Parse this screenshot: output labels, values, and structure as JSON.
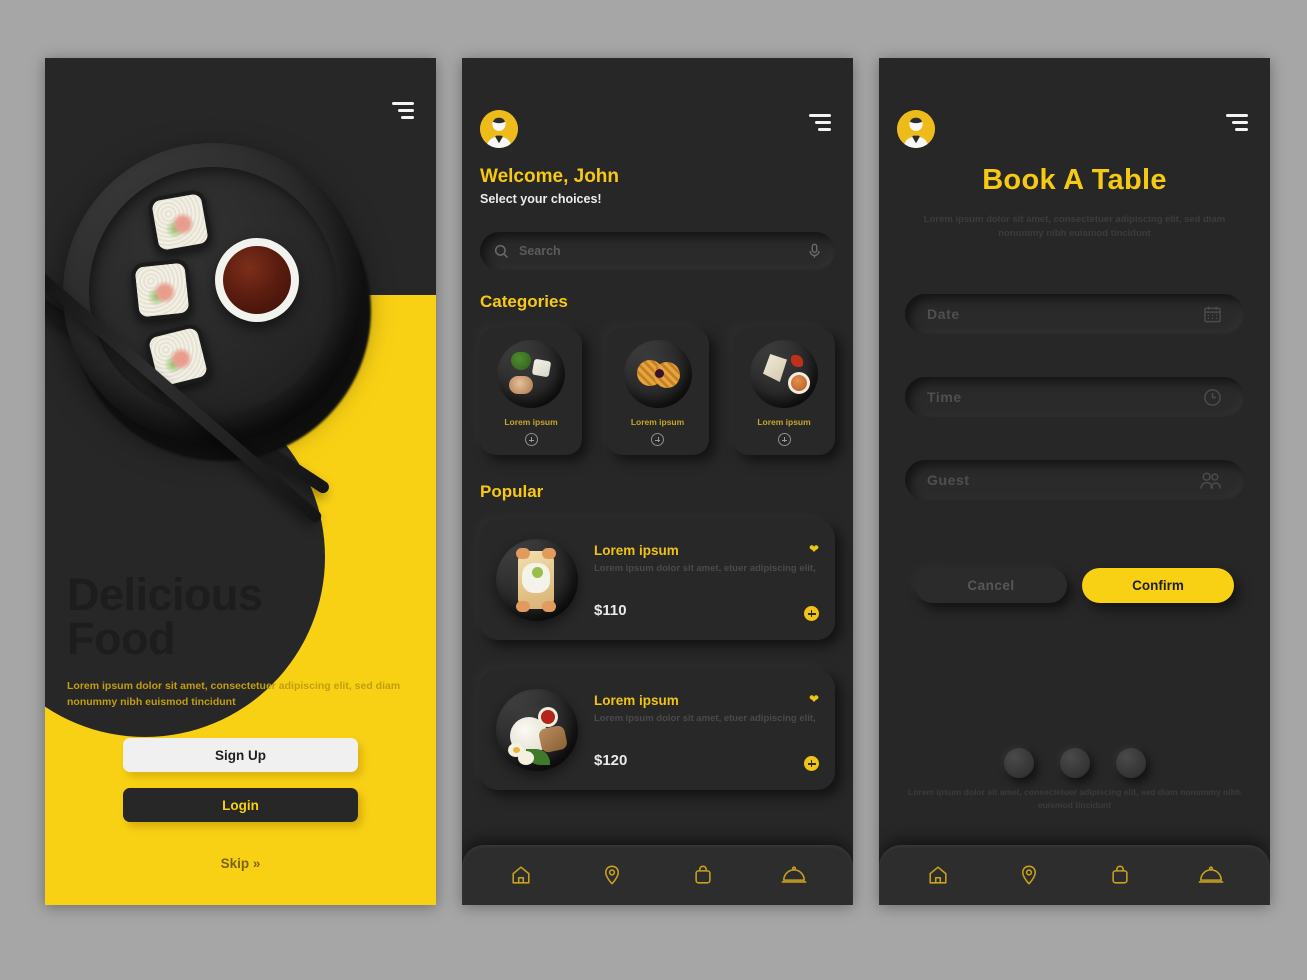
{
  "theme": {
    "background": "#a6a6a6",
    "accent_yellow": "#f9d114",
    "dark_surface": "#272727",
    "text_light": "#ececec"
  },
  "screen1": {
    "name": "Onboarding",
    "title_line1": "Delicious",
    "title_line2": "Food",
    "subtitle": "Lorem ipsum dolor sit amet, consectetuer adipiscing elit, sed diam nonummy nibh euismod tincidunt",
    "signup_label": "Sign Up",
    "login_label": "Login",
    "skip_label": "Skip »",
    "menu_icon": "hamburger-icon"
  },
  "screen2": {
    "name": "Home",
    "avatar_icon": "user-avatar-icon",
    "menu_icon": "hamburger-icon",
    "welcome": "Welcome, John",
    "subtitle": "Select your choices!",
    "search": {
      "placeholder": "Search",
      "left_icon": "search-icon",
      "right_icon": "microphone-icon"
    },
    "categories_title": "Categories",
    "categories": [
      {
        "label": "Lorem ipsum",
        "add_icon": "plus-circle-icon",
        "dish": "broccoli-tofu-meat"
      },
      {
        "label": "Lorem ipsum",
        "add_icon": "plus-circle-icon",
        "dish": "waffles-berry"
      },
      {
        "label": "Lorem ipsum",
        "add_icon": "plus-circle-icon",
        "dish": "cheese-tomato-dip"
      }
    ],
    "popular_title": "Popular",
    "popular": [
      {
        "name": "Lorem ipsum",
        "desc": "Lorem ipsum dolor sit amet, etuer adipiscing elit,",
        "price": "$110",
        "fav_icon": "heart-icon",
        "add_icon": "plus-circle-icon"
      },
      {
        "name": "Lorem ipsum",
        "desc": "Lorem ipsum dolor sit amet, etuer adipiscing elit,",
        "price": "$120",
        "fav_icon": "heart-icon",
        "add_icon": "plus-circle-icon"
      }
    ],
    "nav": [
      {
        "icon": "home-icon"
      },
      {
        "icon": "location-pin-icon"
      },
      {
        "icon": "bag-icon"
      },
      {
        "icon": "food-cloche-icon"
      }
    ]
  },
  "screen3": {
    "name": "Book A Table",
    "avatar_icon": "user-avatar-icon",
    "menu_icon": "hamburger-icon",
    "title": "Book A Table",
    "subtitle": "Lorem ipsum dolor sit amet, consectetuer adipiscing elit, sed diam nonummy nibh euismod tincidunt",
    "fields": [
      {
        "label": "Date",
        "icon": "calendar-icon"
      },
      {
        "label": "Time",
        "icon": "clock-icon"
      },
      {
        "label": "Guest",
        "icon": "people-icon"
      }
    ],
    "cancel_label": "Cancel",
    "confirm_label": "Confirm",
    "dots_count": 3,
    "footnote": "Lorem ipsum dolor sit amet, consectetuer adipiscing elit, sed diam nonummy nibh euismod tincidunt",
    "nav": [
      {
        "icon": "home-icon"
      },
      {
        "icon": "location-pin-icon"
      },
      {
        "icon": "bag-icon"
      },
      {
        "icon": "food-cloche-icon"
      }
    ]
  }
}
